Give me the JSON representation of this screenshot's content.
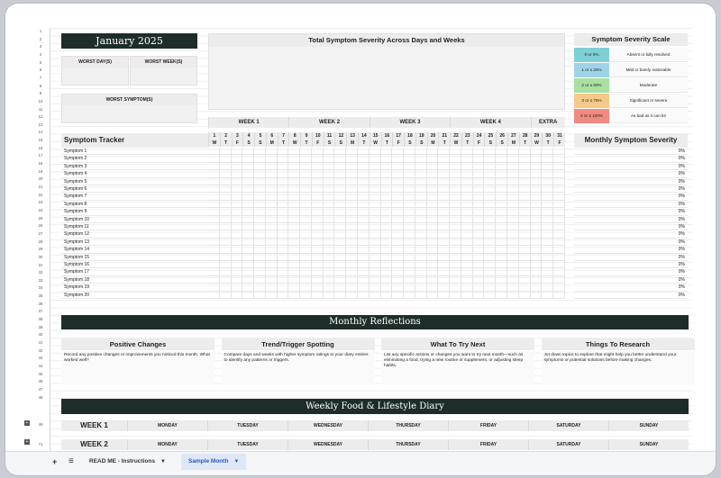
{
  "title": "January 2025",
  "worst": {
    "day_label": "WORST DAY(S)",
    "week_label": "WORST WEEK(S)",
    "symptom_label": "WORST SYMPTOM(S)"
  },
  "chart": {
    "title": "Total Symptom Severity Across Days and Weeks"
  },
  "scale": {
    "title": "Symptom Severity Scale",
    "levels": [
      {
        "swatch": "0 or 0%",
        "desc": "Absent or fully resolved",
        "color": "#7fd0d6"
      },
      {
        "swatch": "1 or ≤ 25%",
        "desc": "Mild or barely noticeable",
        "color": "#9fd3e8"
      },
      {
        "swatch": "2 or ≤ 50%",
        "desc": "Moderate",
        "color": "#a9dfa1"
      },
      {
        "swatch": "3 or ≤ 75%",
        "desc": "Significant or severe",
        "color": "#f5c98a"
      },
      {
        "swatch": "4 or ≤ 100%",
        "desc": "As bad as it can be",
        "color": "#f08a80"
      }
    ]
  },
  "tracker": {
    "title": "Symptom Tracker",
    "weeks": [
      "WEEK 1",
      "WEEK 2",
      "WEEK 3",
      "WEEK 4",
      "EXTRA"
    ],
    "dates": [
      "1",
      "2",
      "3",
      "4",
      "5",
      "6",
      "7",
      "8",
      "9",
      "10",
      "11",
      "12",
      "13",
      "14",
      "15",
      "16",
      "17",
      "18",
      "19",
      "20",
      "21",
      "22",
      "23",
      "24",
      "25",
      "26",
      "27",
      "28",
      "29",
      "30",
      "31"
    ],
    "days": [
      "W",
      "T",
      "F",
      "S",
      "S",
      "M",
      "T",
      "W",
      "T",
      "F",
      "S",
      "S",
      "M",
      "T",
      "W",
      "T",
      "F",
      "S",
      "S",
      "M",
      "T",
      "W",
      "T",
      "F",
      "S",
      "S",
      "M",
      "T",
      "W",
      "T",
      "F"
    ],
    "symptoms": [
      "Symptom 1",
      "Symptom 2",
      "Symptom 3",
      "Symptom 4",
      "Symptom 5",
      "Symptom 6",
      "Symptom 7",
      "Symptom 8",
      "Symptom 9",
      "Symptom 10",
      "Symptom 11",
      "Symptom 12",
      "Symptom 13",
      "Symptom 14",
      "Symptom 15",
      "Symptom 16",
      "Symptom 17",
      "Symptom 18",
      "Symptom 19",
      "Symptom 20"
    ]
  },
  "monthly": {
    "title": "Monthly Symptom Severity",
    "percent": "0%"
  },
  "reflections": {
    "title": "Monthly Reflections",
    "boxes": [
      {
        "title": "Positive Changes",
        "body": "Record any positive changes or improvements you noticed this month. What worked well?"
      },
      {
        "title": "Trend/Trigger Spotting",
        "body": "Compare days and weeks with higher symptom ratings to your diary entries to identify any patterns or triggers."
      },
      {
        "title": "What To Try Next",
        "body": "List any specific actions or changes you want to try next month—such as eliminating a food, trying a new routine or supplement, or adjusting sleep habits."
      },
      {
        "title": "Things To Research",
        "body": "Jot down topics to explore that might help you better understand your symptoms or potential solutions before making changes."
      }
    ]
  },
  "diary": {
    "title": "Weekly Food & Lifestyle Diary",
    "weeks": [
      "WEEK 1",
      "WEEK 2"
    ],
    "days": [
      "MONDAY",
      "TUESDAY",
      "WEDNESDAY",
      "THURSDAY",
      "FRIDAY",
      "SATURDAY",
      "SUNDAY"
    ]
  },
  "rownums": [
    "1",
    "2",
    "3",
    "4",
    "5",
    "6",
    "7",
    "8",
    "9",
    "10",
    "11",
    "12",
    "13",
    "14",
    "15",
    "16",
    "17",
    "18",
    "19",
    "20",
    "21",
    "22",
    "23",
    "24",
    "25",
    "26",
    "27",
    "28",
    "29",
    "30",
    "31",
    "32",
    "33",
    "34",
    "35",
    "36",
    "37",
    "38",
    "39",
    "40",
    "41",
    "42",
    "43",
    "44",
    "45",
    "46",
    "47",
    "48",
    "49",
    "71"
  ],
  "tabs": {
    "add": "+",
    "menu": "≡",
    "sheets": [
      "READ ME - Instructions",
      "Sample Month"
    ]
  }
}
